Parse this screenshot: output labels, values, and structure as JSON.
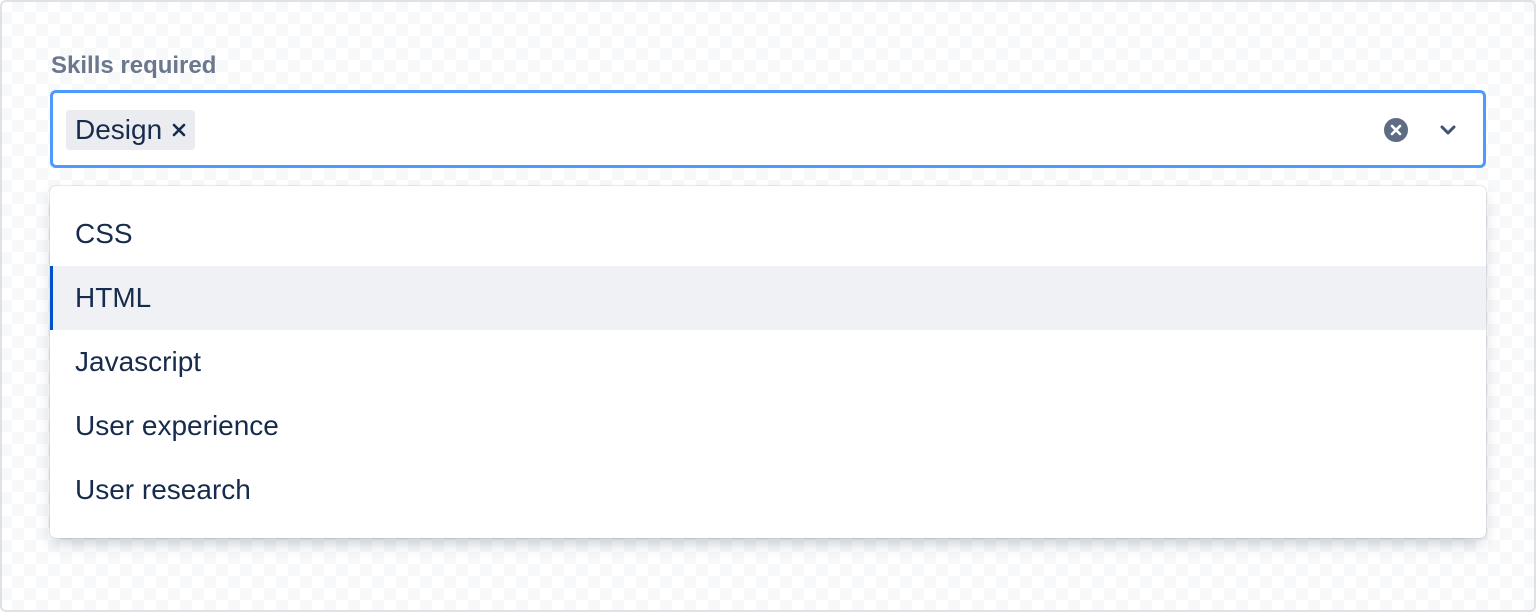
{
  "field": {
    "label": "Skills required"
  },
  "select": {
    "selected_tags": [
      {
        "label": "Design"
      }
    ],
    "menu_open": true,
    "focused_option_index": 1
  },
  "options": [
    {
      "label": "CSS"
    },
    {
      "label": "HTML"
    },
    {
      "label": "Javascript"
    },
    {
      "label": "User experience"
    },
    {
      "label": "User research"
    }
  ],
  "icons": {
    "tag_remove": "close-icon",
    "clear": "clear-circle-icon",
    "dropdown": "chevron-down-icon"
  },
  "colors": {
    "focus_border": "#4c9aff",
    "label_text": "#6b778c",
    "text": "#172b4d",
    "tag_bg": "#ebecf0",
    "option_focus_bg": "#f0f1f5",
    "option_focus_accent": "#0052cc"
  }
}
